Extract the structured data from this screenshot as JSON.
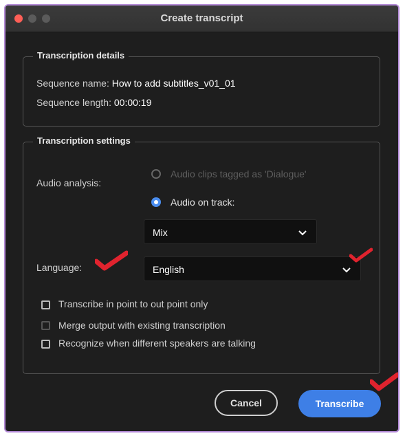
{
  "window": {
    "title": "Create transcript"
  },
  "details": {
    "legend": "Transcription details",
    "sequence_name_label": "Sequence name:",
    "sequence_name_value": "How to add subtitles_v01_01",
    "sequence_length_label": "Sequence length:",
    "sequence_length_value": "00:00:19"
  },
  "settings": {
    "legend": "Transcription settings",
    "audio_analysis_label": "Audio analysis:",
    "radio_dialogue_label": "Audio clips tagged as 'Dialogue'",
    "radio_track_label": "Audio on track:",
    "track_select_value": "Mix",
    "language_label": "Language:",
    "language_select_value": "English",
    "options": [
      {
        "label": "Transcribe in point to out point only",
        "checked": false
      },
      {
        "label": "Merge output with existing transcription",
        "checked": false
      },
      {
        "label": "Recognize when different speakers are talking",
        "checked": false
      }
    ]
  },
  "buttons": {
    "cancel_label": "Cancel",
    "primary_label": "Transcribe"
  },
  "colors": {
    "accent": "#3e7fe6",
    "annotation": "#e0232e",
    "background": "#1e1e1e"
  },
  "icons": [
    "close-window-icon",
    "minimize-window-icon",
    "zoom-window-icon",
    "chevron-down-icon",
    "annotation-checkmark-icon"
  ]
}
